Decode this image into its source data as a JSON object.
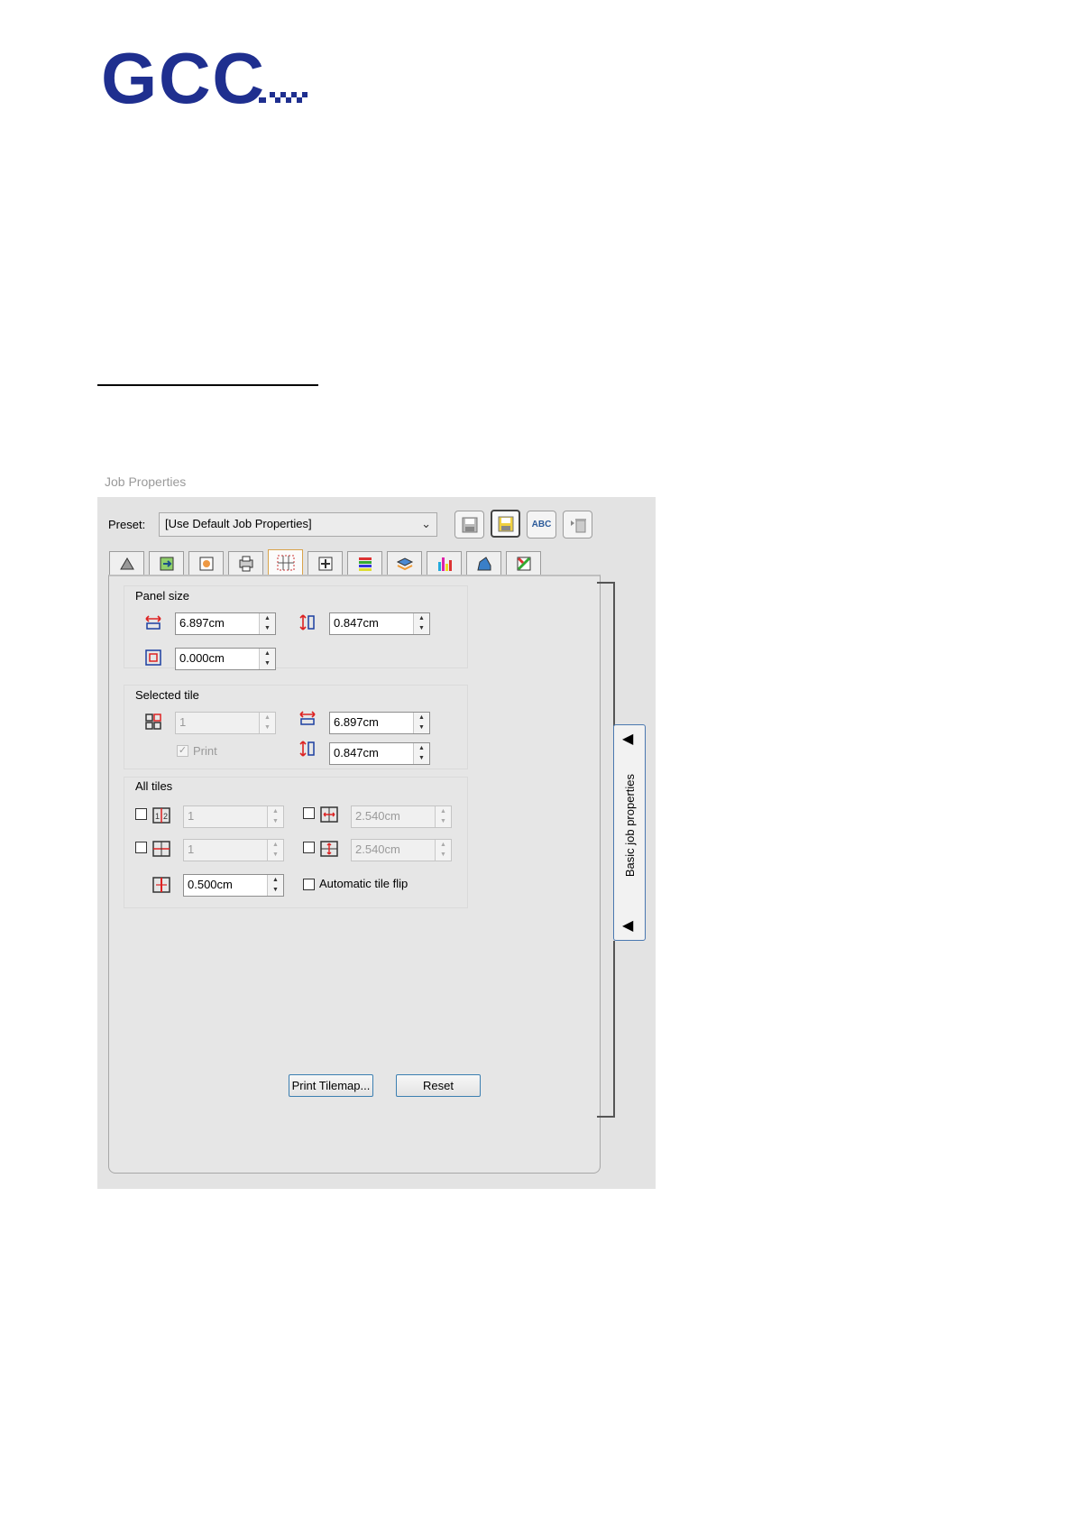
{
  "brand": {
    "logo_text": "GCC",
    "logo_color": "#1f2f8f"
  },
  "dialog": {
    "caption": "Job Properties",
    "preset": {
      "label": "Preset:",
      "value": "[Use Default Job Properties]"
    },
    "toolbar": {
      "abc_label": "ABC"
    },
    "panel_size": {
      "title": "Panel size",
      "width": "6.897cm",
      "height": "0.847cm",
      "margin": "0.000cm"
    },
    "selected_tile": {
      "title": "Selected tile",
      "index": "1",
      "width": "6.897cm",
      "height": "0.847cm",
      "print_label": "Print"
    },
    "all_tiles": {
      "title": "All tiles",
      "columns": "1",
      "rows": "1",
      "h_overlap": "2.540cm",
      "v_overlap": "2.540cm",
      "gap": "0.500cm",
      "auto_flip_label": "Automatic tile flip"
    },
    "buttons": {
      "print_tilemap": "Print Tilemap...",
      "reset": "Reset"
    },
    "side_tab_label": "Basic job properties"
  }
}
